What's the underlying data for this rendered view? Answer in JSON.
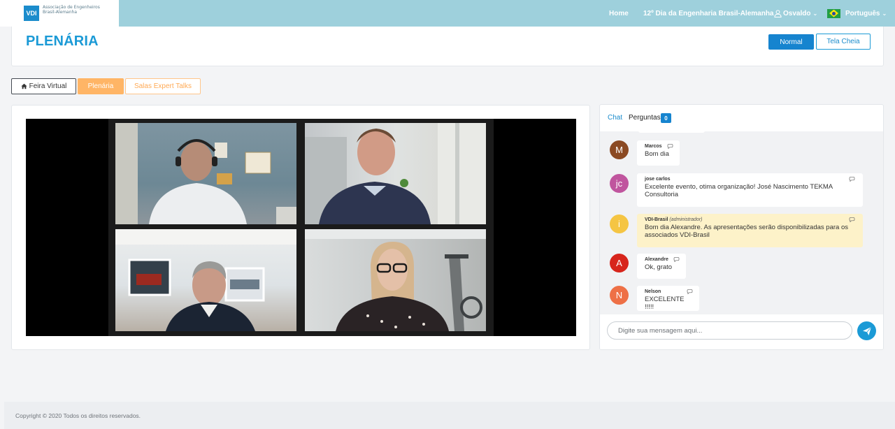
{
  "brand": {
    "badge": "VDI",
    "name": "Associação de Engenheiros Brasil-Alemanha"
  },
  "nav": {
    "home": "Home",
    "event": "12º Dia da Engenharia Brasil-Alemanha",
    "user": "Osvaldo",
    "language": "Português",
    "language_flag": "brazil-flag-icon"
  },
  "header": {
    "title": "PLENÁRIA",
    "view_normal": "Normal",
    "view_full": "Tela Cheia"
  },
  "tabs": {
    "feira": "Feira Virtual",
    "plenaria": "Plenária",
    "salas": "Salas Expert Talks"
  },
  "chat": {
    "tab_chat": "Chat",
    "tab_questions": "Perguntas",
    "questions_count": "0",
    "messages": [
      {
        "initials": "M",
        "name": "Marcos",
        "role": "",
        "text": "Bom dia",
        "avatar_color": "#8b4a23"
      },
      {
        "initials": "jc",
        "name": "jose carlos",
        "role": "",
        "text": "Excelente evento, otima organização! José Nascimento TEKMA Consultoria",
        "avatar_color": "#c0559e"
      },
      {
        "initials": "i",
        "name": "VDI-Brasil",
        "role": "(administrador)",
        "text": "Bom dia Alexandre. As apresentações serão disponibilizadas para os associados VDI-Brasil",
        "avatar_color": "#f5c543"
      },
      {
        "initials": "A",
        "name": "Alexandre",
        "role": "",
        "text": "Ok, grato",
        "avatar_color": "#d7251c"
      },
      {
        "initials": "N",
        "name": "Nelson",
        "role": "",
        "text": "EXCELENTE !!!!!",
        "avatar_color": "#ee7046"
      }
    ],
    "input_placeholder": "Digite sua mensagem aqui..."
  },
  "footer": {
    "copyright": "Copyright © 2020 Todos os direitos reservados."
  },
  "colors": {
    "topbar": "#9ed0dc",
    "accent_blue": "#1b9ad6",
    "accent_orange": "#ffb566"
  }
}
